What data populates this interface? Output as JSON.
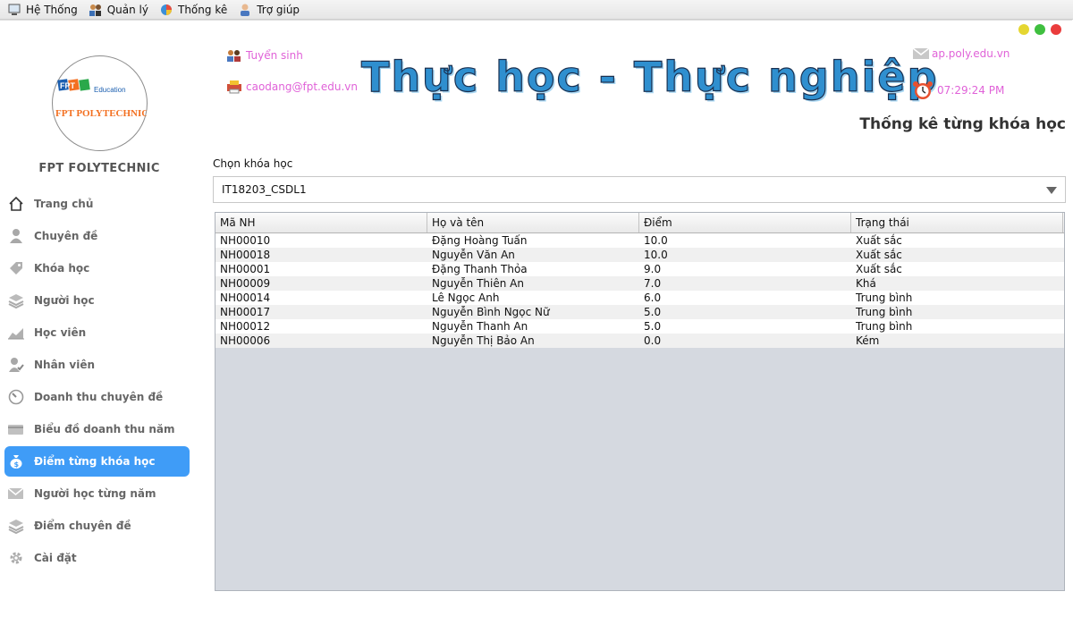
{
  "menubar": {
    "items": [
      {
        "label": "Hệ Thống",
        "icon": "system-icon"
      },
      {
        "label": "Quản lý",
        "icon": "management-icon"
      },
      {
        "label": "Thống kê",
        "icon": "statistics-icon"
      },
      {
        "label": "Trợ giúp",
        "icon": "help-icon"
      }
    ]
  },
  "window": {
    "controls": [
      {
        "name": "minimize",
        "color": "#e5d631"
      },
      {
        "name": "maximize",
        "color": "#3fbf3f"
      },
      {
        "name": "close",
        "color": "#ea3c3c"
      }
    ]
  },
  "sidebar": {
    "logo": {
      "brand": "FPT",
      "sub": "Education",
      "name": "FPT POLYTECHNIC"
    },
    "brand_name": "FPT FOLYTECHNIC",
    "items": [
      {
        "label": "Trang chủ",
        "icon": "home-icon",
        "active": false
      },
      {
        "label": "Chuyên đề",
        "icon": "user-icon",
        "active": false
      },
      {
        "label": "Khóa học",
        "icon": "tag-icon",
        "active": false
      },
      {
        "label": "Người học",
        "icon": "books-icon",
        "active": false
      },
      {
        "label": "Học viên",
        "icon": "trend-chart-icon",
        "active": false
      },
      {
        "label": "Nhân viên",
        "icon": "user-check-icon",
        "active": false
      },
      {
        "label": "Doanh thu chuyên đề",
        "icon": "gauge-icon",
        "active": false
      },
      {
        "label": "Biểu đồ doanh thu năm",
        "icon": "card-icon",
        "active": false
      },
      {
        "label": "Điểm từng khóa học",
        "icon": "money-bag-icon",
        "active": true
      },
      {
        "label": "Người học từng năm",
        "icon": "mail-icon",
        "active": false
      },
      {
        "label": "Điểm chuyên đề",
        "icon": "stack-icon",
        "active": false
      },
      {
        "label": "Cài đặt",
        "icon": "gear-icon",
        "active": false
      }
    ]
  },
  "header": {
    "admission": "Tuyển sinh",
    "email": "caodang@fpt.edu.vn",
    "slogan": "Thực học - Thực nghiệp",
    "website": "ap.poly.edu.vn",
    "clock": "07:29:24 PM",
    "page_title": "Thống kê từng khóa học",
    "colors": {
      "link": "#e062d8",
      "active_nav": "#3f9cf7"
    }
  },
  "content": {
    "select_label": "Chọn khóa học",
    "selected_course": "IT18203_CSDL1",
    "table": {
      "columns": [
        "Mã NH",
        "Họ và tên",
        "Điểm",
        "Trạng thái"
      ],
      "rows": [
        [
          "NH00010",
          "Đặng Hoàng Tuấn",
          "10.0",
          "Xuất sắc"
        ],
        [
          "NH00018",
          "Nguyễn Văn An",
          "10.0",
          "Xuất sắc"
        ],
        [
          "NH00001",
          "Đặng Thanh Thỏa",
          "9.0",
          "Xuất sắc"
        ],
        [
          "NH00009",
          "Nguyễn Thiên An",
          "7.0",
          "Khá"
        ],
        [
          "NH00014",
          "Lê Ngọc Anh",
          "6.0",
          "Trung bình"
        ],
        [
          "NH00017",
          "Nguyễn Bình Ngọc Nữ",
          "5.0",
          "Trung bình"
        ],
        [
          "NH00012",
          "Nguyễn Thanh An",
          "5.0",
          "Trung bình"
        ],
        [
          "NH00006",
          "Nguyễn Thị Bảo An",
          "0.0",
          "Kém"
        ]
      ]
    }
  }
}
